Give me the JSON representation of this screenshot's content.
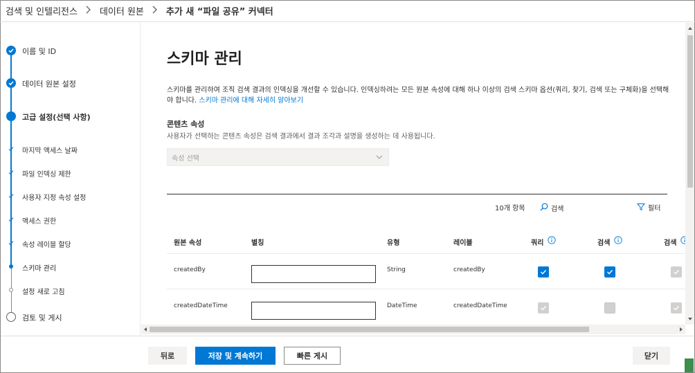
{
  "breadcrumb": {
    "items": [
      "검색 및 인텔리전스",
      "데이터 원본",
      "추가 새 “파일 공유” 커넥터"
    ]
  },
  "steps": {
    "name_id": "이름 및 ID",
    "data_source": "데이터 원본 설정",
    "advanced": "고급 설정(선택 사항)",
    "sub_last_access": "마지막 액세스 날짜",
    "sub_file_index_limit": "파일 인덱싱 제한",
    "sub_custom_props": "사용자 지정 속성 설정",
    "sub_access": "액세스 권한",
    "sub_label": "속성 레이블 할당",
    "sub_schema": "스키마 관리",
    "refresh": "설정 새로 고침",
    "review": "검토 및 게시"
  },
  "main": {
    "title": "스키마 관리",
    "desc_text": "스키마를 관리하여 조직 검색 결과의 인덱싱을 개선할 수 있습니다. 인덱싱하려는 모든 원본 속성에 대해 하나 이상의 검색 스키마 옵션(쿼리, 찾기, 검색 또는 구체화)을 선택해야 합니다. ",
    "desc_link": "스키마 관리에 대해 자세히 알아보기",
    "content_title": "콘텐츠 속성",
    "content_desc": "사용자가 선택하는 콘텐츠 속성은 검색 결과에서 결과 조각과 설명을 생성하는 데 사용됩니다.",
    "dropdown_placeholder": "속성 선택",
    "item_count": "10개 항목",
    "search_label": "검색",
    "filter_label": "필터"
  },
  "table": {
    "headers": {
      "source": "원본 속성",
      "alias": "별칭",
      "type": "유형",
      "label": "레이블",
      "query": "쿼리",
      "search": "검색",
      "retrieve": "검색"
    },
    "rows": [
      {
        "source": "createdBy",
        "type": "String",
        "label": "createdBy",
        "query": "checked",
        "search": "checked",
        "retrieve": "checked-disabled"
      },
      {
        "source": "createdDateTime",
        "type": "DateTime",
        "label": "createdDateTime",
        "query": "checked-disabled",
        "search": "unchecked-disabled",
        "retrieve": "checked-disabled"
      }
    ]
  },
  "footer": {
    "back": "뒤로",
    "save_continue": "저장 및 계속하기",
    "quick_publish": "빠른 게시",
    "close": "닫기"
  },
  "colors": {
    "accent": "#0078d4",
    "text": "#323130"
  }
}
